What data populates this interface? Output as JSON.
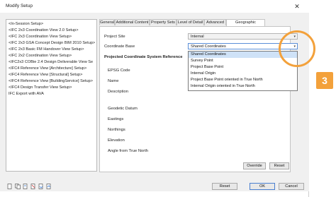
{
  "window": {
    "title": "Modify Setup",
    "close_glyph": "✕"
  },
  "left_list": {
    "items": [
      "<In-Session Setup>",
      "<IFC 2x3 Coordination View 2.0 Setup>",
      "<IFC 2x3 Coordination View Setup>",
      "<IFC 2x3 GSA Concept Design BIM 2010 Setup>",
      "<IFC 2x3 Basic FM Handover View Setup>",
      "<IFC 2x2 Coordination View Setup>",
      "<IFC2x3 COBie 2.4 Design Deliverable View Se",
      "<IFC4 Reference View [Architecture] Setup>",
      "<IFC4 Reference View [Structural] Setup>",
      "<IFC4 Reference View [BuildingService] Setup>",
      "<IFC4 Design Transfer View Setup>",
      "IFC Export with AVA"
    ]
  },
  "tabs": [
    "General",
    "Additional Content",
    "Property Sets",
    "Level of Detail",
    "Advanced",
    "Geographic Reference"
  ],
  "form": {
    "project_site_label": "Project Site",
    "project_site_value": "Internal",
    "coordinate_base_label": "Coordinate Base",
    "coordinate_base_value": "Shared Coordinates",
    "section_title": "Projected Coordinate System Reference",
    "epsg_label": "EPSG Code",
    "name_label": "Name",
    "description_label": "Description",
    "geodetic_label": "Geodetic Datum",
    "eastings_label": "Eastings",
    "northings_label": "Northings",
    "elevation_label": "Elevation",
    "angle_label": "Angle from True North"
  },
  "dropdown": {
    "options": [
      "Shared Coordinates",
      "Survey Point",
      "Project Base Point",
      "Internal Origin",
      "Project Base Point oriented in True North",
      "Internal Origin oriented in True North"
    ],
    "selected": "Shared Coordinates"
  },
  "buttons": {
    "override": "Override",
    "reset_inner": "Reset",
    "reset": "Reset",
    "ok": "OK",
    "cancel": "Cancel"
  },
  "callout": {
    "number": "3",
    "color": "#f3a13b"
  }
}
